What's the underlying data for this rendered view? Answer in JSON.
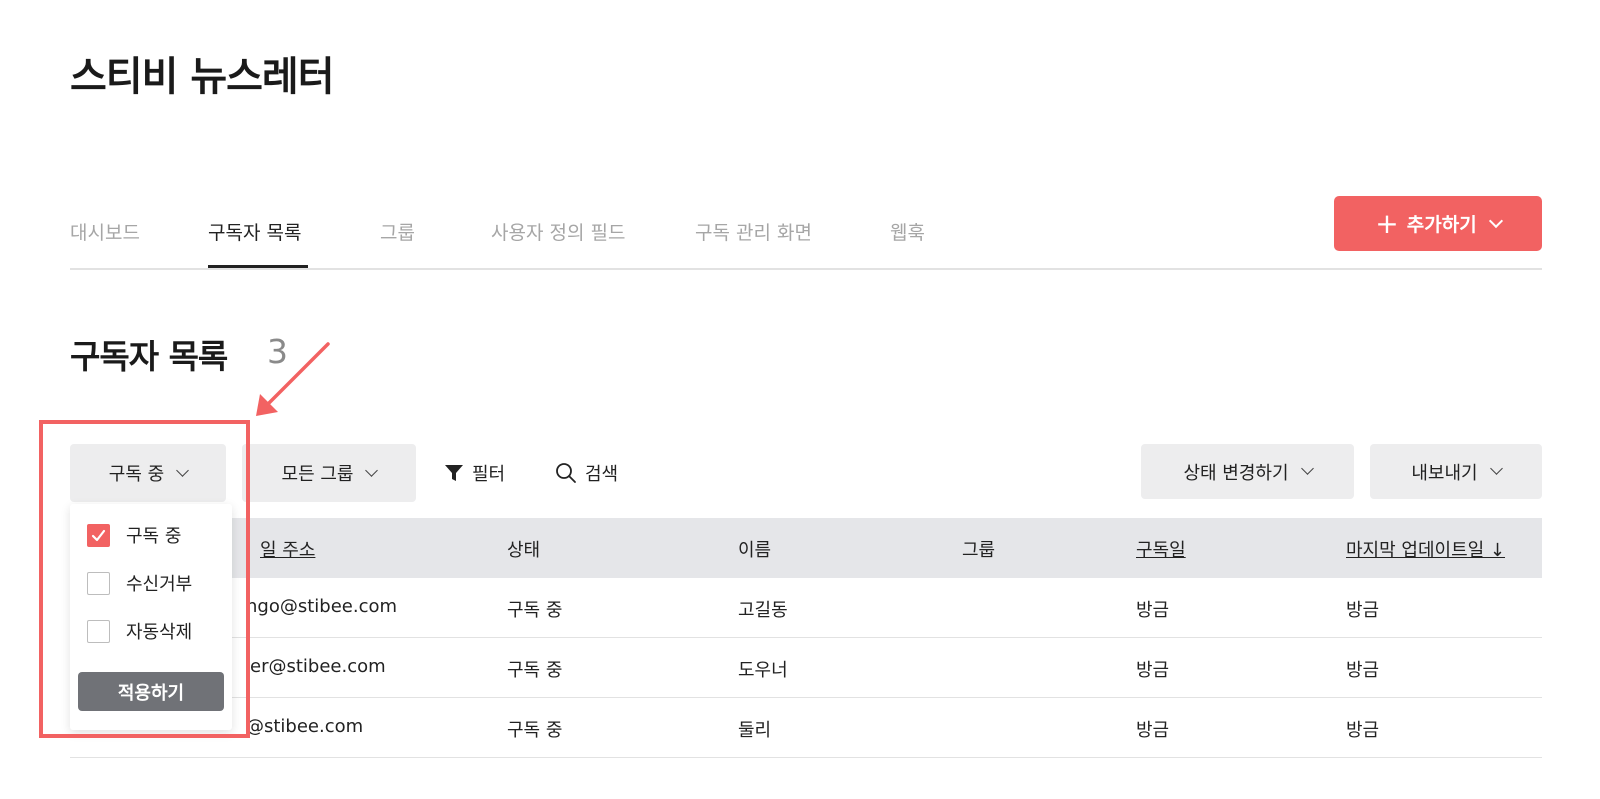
{
  "app": {
    "title": "스티비 뉴스레터"
  },
  "tabs": [
    {
      "label": "대시보드"
    },
    {
      "label": "구독자 목록"
    },
    {
      "label": "그룹"
    },
    {
      "label": "사용자 정의 필드"
    },
    {
      "label": "구독 관리 화면"
    },
    {
      "label": "웹훅"
    }
  ],
  "active_tab": "구독자 목록",
  "add_button": {
    "icon": "plus-icon",
    "label": "추가하기"
  },
  "section": {
    "title": "구독자 목록",
    "count": "3"
  },
  "toolbar": {
    "status_dropdown": "구독 중",
    "group_dropdown": "모든 그룹",
    "filter_label": "필터",
    "search_label": "검색",
    "change_status": "상태 변경하기",
    "export": "내보내기"
  },
  "status_menu": {
    "options": [
      {
        "label": "구독 중",
        "checked": true
      },
      {
        "label": "수신거부",
        "checked": false
      },
      {
        "label": "자동삭제",
        "checked": false
      }
    ],
    "apply_label": "적용하기"
  },
  "table": {
    "headers": {
      "email_partial": "일 주소",
      "status": "상태",
      "name": "이름",
      "group": "그룹",
      "subscribed": "구독일",
      "updated": "마지막 업데이트일 ↓"
    },
    "rows": [
      {
        "email_partial": "ngo@stibee.com",
        "status": "구독 중",
        "name": "고길동",
        "group": "",
        "subscribed": "방금",
        "updated": "방금"
      },
      {
        "email_partial": "er@stibee.com",
        "status": "구독 중",
        "name": "도우너",
        "group": "",
        "subscribed": "방금",
        "updated": "방금"
      },
      {
        "email_partial": "@stibee.com",
        "status": "구독 중",
        "name": "둘리",
        "group": "",
        "subscribed": "방금",
        "updated": "방금"
      }
    ]
  },
  "colors": {
    "accent": "#f26262",
    "button_gray": "#ededee",
    "header_gray": "#e5e6e9",
    "apply_button": "#707277"
  }
}
